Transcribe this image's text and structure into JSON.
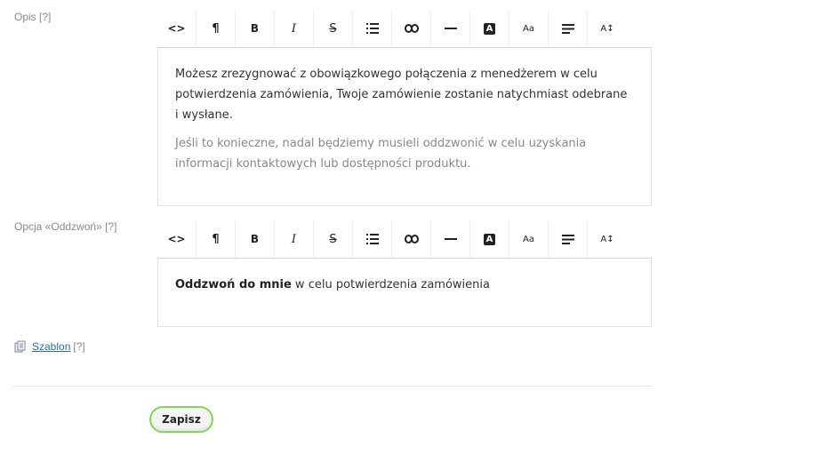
{
  "description_field": {
    "label": "Opis",
    "help": "[?]",
    "paragraph1": "Możesz zrezygnować z obowiązkowego połączenia z menedżerem w celu potwierdzenia zamówienia, Twoje zamówienie zostanie natychmiast odebrane i wysłane.",
    "paragraph2": "Jeśli to konieczne, nadal będziemy musieli oddzwonić w celu uzyskania informacji kontaktowych lub dostępności produktu."
  },
  "callback_field": {
    "label": "Opcja «Oddzwoń»",
    "help": "[?]",
    "bold_text": "Oddzwoń do mnie",
    "rest_text": " w celu potwierdzenia zamówienia"
  },
  "toolbar": {
    "bold": "B",
    "italic": "I",
    "strike": "S",
    "font_size": "Aa",
    "line_height": "A↕",
    "highlight": "A",
    "paragraph": "¶",
    "code": "<>"
  },
  "template": {
    "link_text": "Szablon",
    "help": "[?]"
  },
  "actions": {
    "save_label": "Zapisz"
  },
  "colors": {
    "accent_border": "#7ed957",
    "link": "#2a6ebb"
  }
}
